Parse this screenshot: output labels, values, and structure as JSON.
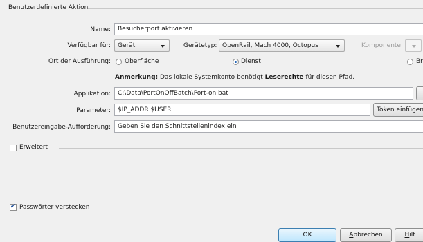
{
  "group": {
    "title": "Benutzerdefinierte Aktion"
  },
  "form": {
    "name_label": "Name:",
    "name_value": "Besucherport aktivieren",
    "available_label": "Verfügbar für:",
    "available_value": "Gerät",
    "devicetype_label": "Gerätetyp:",
    "devicetype_value": "OpenRail, Mach 4000, Octopus",
    "component_label": "Komponente:",
    "component_value": "",
    "exec_label": "Ort der Ausführung:",
    "exec_options": [
      {
        "label": "Oberfläche",
        "selected": false
      },
      {
        "label": "Dienst",
        "selected": true
      },
      {
        "label": "Br",
        "selected": false
      }
    ],
    "note_prefix": "Anmerkung:",
    "note_mid": " Das lokale Systemkonto benötigt ",
    "note_bold": "Leserechte",
    "note_suffix": " für diesen Pfad.",
    "app_label": "Applikation:",
    "app_value": "C:\\Data\\PortOnOffBatch\\Port-on.bat",
    "param_label": "Parameter:",
    "param_value": "$IP_ADDR $USER",
    "token_button": "Token einfügen",
    "prompt_label": "Benutzereingabe-Aufforderung:",
    "prompt_value": "Geben Sie den Schnittstellenindex ein"
  },
  "extended": {
    "label": "Erweitert",
    "checked": false
  },
  "hide_passwords": {
    "label": "Passwörter verstecken",
    "checked": true
  },
  "buttons": {
    "ok": "OK",
    "cancel_underline": "A",
    "cancel_rest": "bbrechen",
    "help_underline": "H",
    "help_rest": "ilf"
  }
}
